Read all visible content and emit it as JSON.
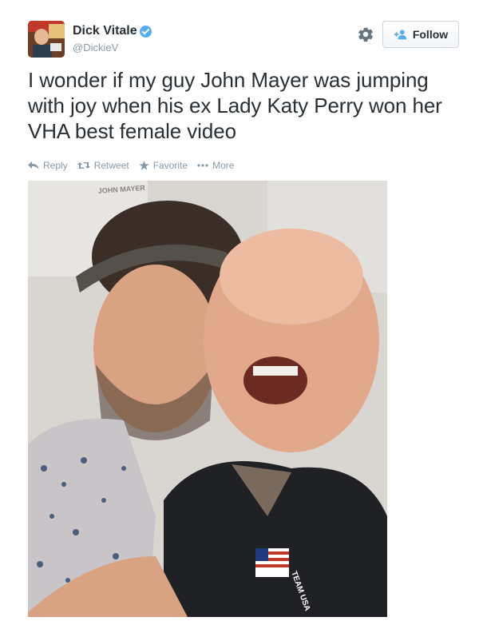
{
  "user": {
    "display_name": "Dick Vitale",
    "handle": "@DickieV",
    "verified": true
  },
  "follow_button": {
    "label": "Follow"
  },
  "tweet": {
    "text": "I wonder if my guy John Mayer was jumping with joy when his ex Lady Katy Perry won her VHA best female video"
  },
  "actions": {
    "reply": "Reply",
    "retweet": "Retweet",
    "favorite": "Favorite",
    "more": "More"
  },
  "photo": {
    "backdrop_text": "JOHN MAYER",
    "jacket_text": "TEAM USA",
    "description": "photo"
  },
  "icons": [
    "verified-icon",
    "gear-icon",
    "follow-icon",
    "reply-icon",
    "retweet-icon",
    "favorite-icon",
    "more-icon"
  ],
  "colors": {
    "accent": "#55acee",
    "text": "#292f33",
    "muted": "#8899a6"
  }
}
